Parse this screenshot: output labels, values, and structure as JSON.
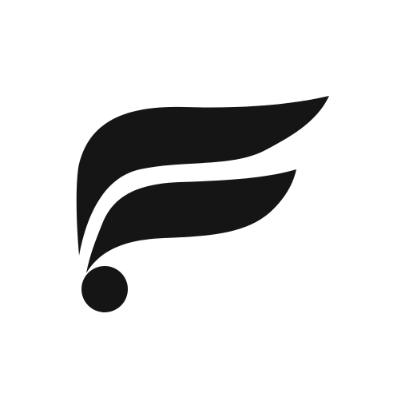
{
  "logo": {
    "icon": "stylized-f-wing-logo",
    "color": "#151515",
    "background": "#ffffff"
  }
}
